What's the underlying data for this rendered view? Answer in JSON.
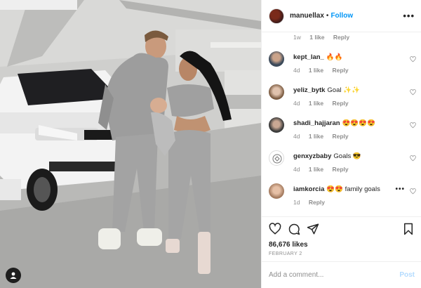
{
  "post": {
    "header": {
      "username": "manuellax",
      "separator": "•",
      "follow_label": "Follow",
      "more_label": "•••",
      "avatar_icon": "user-avatar-icon"
    },
    "photo": {
      "profile_icon": "person-icon"
    },
    "prev_comment_meta": {
      "age": "1w",
      "likes": "1 like",
      "reply": "Reply"
    },
    "comments": [
      {
        "username": "kept_lan_",
        "text": "🔥🔥",
        "age": "4d",
        "likes": "1 like",
        "reply": "Reply"
      },
      {
        "username": "yeliz_bytk",
        "text": "Goal ✨✨",
        "age": "4d",
        "likes": "1 like",
        "reply": "Reply"
      },
      {
        "username": "shadi_hajjaran",
        "text": "😍😍😍😍",
        "age": "4d",
        "likes": "1 like",
        "reply": "Reply"
      },
      {
        "username": "genxyzbaby",
        "text": "Goals 😎",
        "age": "4d",
        "likes": "1 like",
        "reply": "Reply"
      },
      {
        "username": "iamkorcia",
        "text": "😍😍 family goals",
        "age": "1d",
        "likes": "",
        "reply": "Reply",
        "more_label": "•••"
      }
    ],
    "actions": {
      "icons": [
        "heart-icon",
        "comment-icon",
        "share-icon",
        "bookmark-icon"
      ],
      "likes_count": "86,676 likes",
      "date": "FEBRUARY 2"
    },
    "add_comment": {
      "placeholder": "Add a comment...",
      "post_label": "Post"
    }
  },
  "colors": {
    "link_blue": "#0095f6",
    "post_disabled": "#b3dbff",
    "meta_gray": "#8e8e8e",
    "text": "#262626"
  }
}
